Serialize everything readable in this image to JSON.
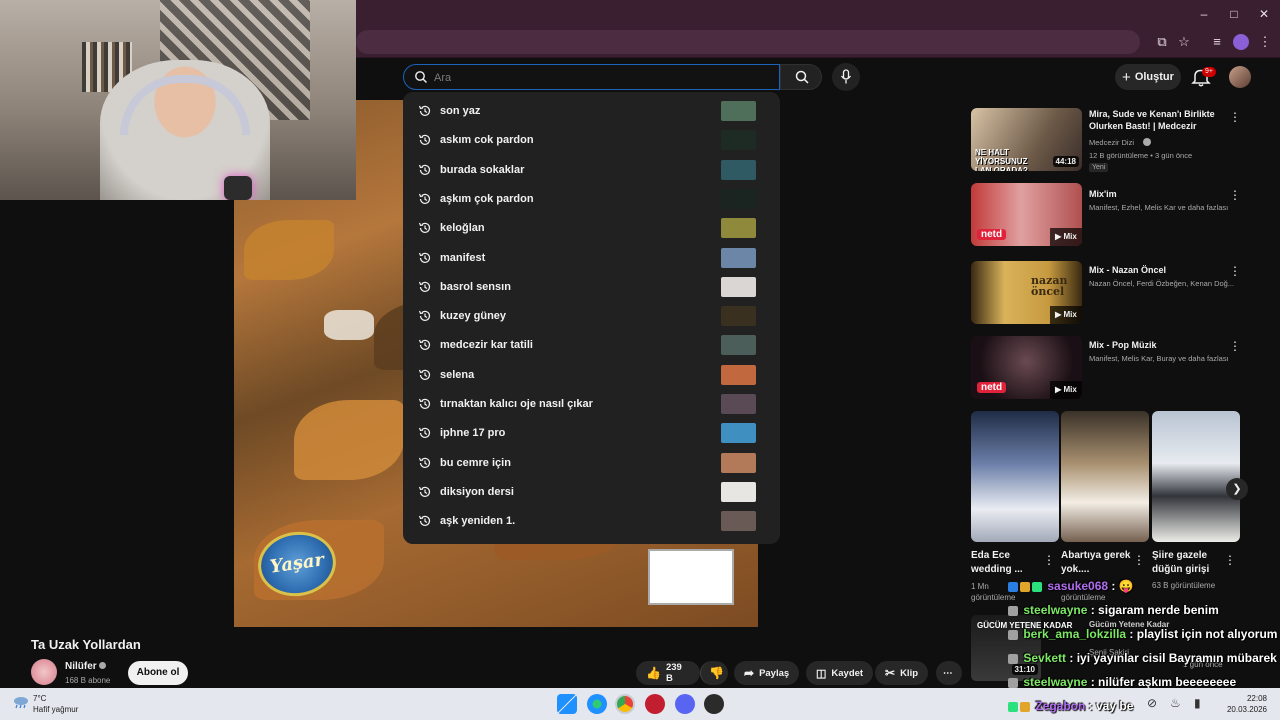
{
  "search": {
    "placeholder": "Ara",
    "suggestions": [
      {
        "text": "son yaz",
        "thumb": "#4f6f5b"
      },
      {
        "text": "askım cok pardon",
        "thumb": "#1e2a24"
      },
      {
        "text": "burada sokaklar",
        "thumb": "#2f5a63"
      },
      {
        "text": "aşkım çok pardon",
        "thumb": "#1a2420"
      },
      {
        "text": "keloğlan",
        "thumb": "#8f8a3b"
      },
      {
        "text": "manifest",
        "thumb": "#6b86a6"
      },
      {
        "text": "basrol sensın",
        "thumb": "#d9d6d4"
      },
      {
        "text": "kuzey güney",
        "thumb": "#3a3020"
      },
      {
        "text": "medcezir kar tatili",
        "thumb": "#4b5e59"
      },
      {
        "text": "selena",
        "thumb": "#c2683f"
      },
      {
        "text": "tırnaktan kalıcı oje nasıl çıkar",
        "thumb": "#5a4a55"
      },
      {
        "text": "iphne 17 pro",
        "thumb": "#3f8fc0"
      },
      {
        "text": "bu cemre için",
        "thumb": "#b37a5a"
      },
      {
        "text": "diksiyon dersi",
        "thumb": "#e8e6e2"
      },
      {
        "text": "aşk yeniden 1.",
        "thumb": "#6a5a55"
      }
    ]
  },
  "header": {
    "create_label": "Oluştur",
    "notif_count": "9+"
  },
  "recommendations": [
    {
      "title": "Mira, Sude ve Kenan'ı Birlikte Olurken Bastı! | Medcezir",
      "channel": "Medcezir Dizi",
      "meta": "12 B görüntüleme • 3 gün önce",
      "badge": "Yeni",
      "duration": "44:18",
      "overlay_text": "NE HALT YİYORSUNUZ LAN ORADA?",
      "color": "#b39a7a"
    },
    {
      "title": "Mix'im",
      "channel": "Manifest, Ezhel, Melis Kar ve daha fazlası",
      "mix": "Mix",
      "logo": "netd",
      "color": "#c23a3a"
    },
    {
      "title": "Mix - Nazan Öncel",
      "channel": "Nazan Öncel, Ferdi Özbeğen, Kenan Doğ...",
      "mix": "Mix",
      "overlay_text": "nazan öncel",
      "color": "#c9a85a"
    },
    {
      "title": "Mix - Pop Müzik",
      "channel": "Manifest, Melis Kar, Buray ve daha fazlası",
      "mix": "Mix",
      "logo": "netd",
      "color": "#2a1a22"
    }
  ],
  "shorts": [
    {
      "title": "Eda Ece wedding ...",
      "views": "1 Mn görüntüleme"
    },
    {
      "title": "Abartıya gerek yok....",
      "views": "görüntüleme"
    },
    {
      "title": "Şiire gazele düğün girişi",
      "views": "63 B görüntüleme"
    }
  ],
  "video": {
    "title": "Ta Uzak Yollardan",
    "channel": "Nilüfer",
    "subs": "168 B abone",
    "subscribe_label": "Abone ol",
    "likes": "239 B",
    "share_label": "Paylaş",
    "save_label": "Kaydet",
    "clip_label": "Klip",
    "logo_text": "Yaşar"
  },
  "ghost_rec": {
    "title": "GÜCÜM YETENE KADAR",
    "line": "Gücüm Yetene Kadar",
    "channel": "Şenii Şakiri",
    "meta": "1 gün önce",
    "duration": "31:10"
  },
  "chat": [
    {
      "user": "sasuke068",
      "msg": " : 😛"
    },
    {
      "user": "steelwayne",
      "msg": " : sigaram nerde benim"
    },
    {
      "user": "berk_ama_lokzilla",
      "msg": " : playlist için not alıyorum"
    },
    {
      "user": "Sevkett",
      "msg": " : iyi yayınlar cisil Bayramın mübarek"
    },
    {
      "user": "steelwayne",
      "msg": " : nilüfer aşkım beeeeeeee"
    },
    {
      "user": "Zegabon",
      "msg": " : vay be"
    }
  ],
  "taskbar": {
    "temp": "7°C",
    "condition": "Hafif yağmur",
    "time": "22:08",
    "date": "20.03.2026"
  }
}
